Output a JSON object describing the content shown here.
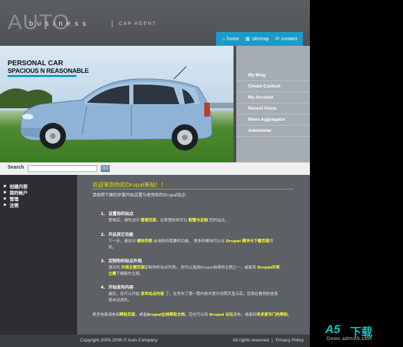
{
  "header": {
    "logo_big": "AUTO",
    "logo_small": "business",
    "logo_sep": "|",
    "logo_sub": "CAR AGENT"
  },
  "topnav": [
    {
      "label": "home",
      "icon": "home-icon",
      "glyph": "⌂"
    },
    {
      "label": "sitemap",
      "icon": "sitemap-icon",
      "glyph": "▦"
    },
    {
      "label": "contact",
      "icon": "mail-icon",
      "glyph": "✉"
    }
  ],
  "hero": {
    "title": "PERSONAL CAR",
    "subtitle": "SPACIOUS N REASONABLE"
  },
  "sidebar": {
    "items": [
      {
        "label": "My Blog"
      },
      {
        "label": "Create Content"
      },
      {
        "label": "My Account"
      },
      {
        "label": "Recent Posts"
      },
      {
        "label": "News Aggregator"
      },
      {
        "label": "Administer"
      }
    ]
  },
  "search": {
    "label": "Search",
    "value": "",
    "button": "GO"
  },
  "leftnav": {
    "items": [
      {
        "label": "创建内容"
      },
      {
        "label": "我的帐户"
      },
      {
        "label": "管理"
      },
      {
        "label": "注销"
      }
    ]
  },
  "content": {
    "title": "欢迎来到你的Drupal新站！！",
    "intro": "请按照下面的步骤开始设置与使用你的Drupal站点：",
    "steps": [
      {
        "num": "1.",
        "head": "设置你的站点",
        "body_a": "登陆后，请先访问 ",
        "body_hl1": "管理页面",
        "body_b": "，在那里你将可以 ",
        "body_hl2": "配置与定制",
        "body_c": " 您的站点。"
      },
      {
        "num": "2.",
        "head": "开启其它功能",
        "body_a": "下一步，请访问 ",
        "body_hl1": "模块列表",
        "body_b": " 启用你所需要的功能。 更多的模块可以在 ",
        "body_hl2": "Drupal 模块与下载页面",
        "body_c": "找到。"
      },
      {
        "num": "3.",
        "head": "定制你的站点外观",
        "body_a": "请访问 ",
        "body_hl1": "外观主题页面",
        "body_b": "定制你的站点外观。 你可以选用Drupal自带的主题之一，或者到 ",
        "body_hl2": "Drupal外观主题",
        "body_c": "下载新的主题。"
      },
      {
        "num": "4.",
        "head": "开始发布内容",
        "body_a": "最后，您可以开始 ",
        "body_hl1": "发布站点内容",
        "body_b": " 了。在发布了第一篇内容并提升到首页显示后，您现在看到的信息将自动消失。",
        "body_hl2": "",
        "body_c": ""
      }
    ],
    "outro_a": "更多信息请参阅",
    "outro_hl1": "帮助页面",
    "outro_b": "，或者",
    "outro_hl2": "Drupal在线帮助文档",
    "outro_c": "。您也可以到 ",
    "outro_hl3": "Drupal 论坛",
    "outro_d": "发帖，或者到",
    "outro_hl4": "寻求更专门的帮助",
    "outro_e": "。"
  },
  "footer": {
    "copyright": "Copyright 2005-2006 © Auto Company",
    "links": [
      "All rights reserved",
      "|",
      "Privacy Policy"
    ]
  },
  "watermark": {
    "a5": "A5",
    "cn": "下载",
    "url": "Down.admin5.com"
  },
  "colors": {
    "accent": "#1b9bc7",
    "highlight": "#ffff33",
    "title": "#e6e600"
  }
}
